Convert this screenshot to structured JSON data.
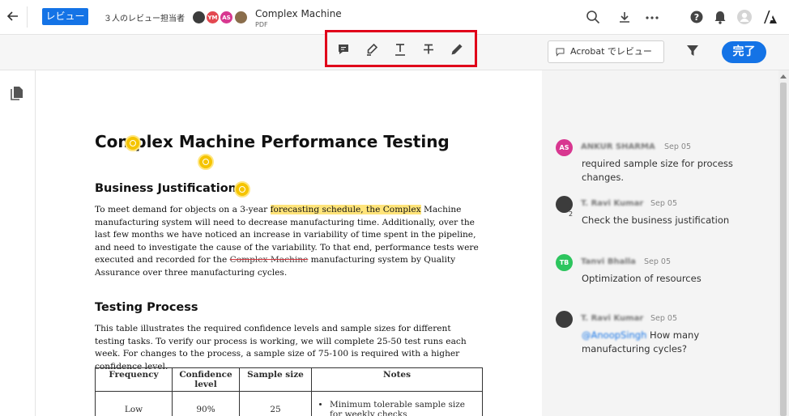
{
  "header": {
    "review_label": "レビュー",
    "reviewers_label": "３人のレビュー担当者",
    "avatars": [
      {
        "initials": "",
        "color": "#3c3c3c"
      },
      {
        "initials": "YM",
        "color": "#e34850"
      },
      {
        "initials": "AS",
        "color": "#d83790"
      },
      {
        "initials": "",
        "color": "#8a6d4b"
      }
    ],
    "doc_title": "Complex Machine",
    "doc_type": "PDF"
  },
  "toolbar": {
    "tools": [
      "comment-icon",
      "highlight-icon",
      "underline-icon",
      "strikethrough-icon",
      "draw-icon"
    ],
    "acrobat_review": "Acrobat でレビュー",
    "done_label": "完了"
  },
  "document": {
    "title": "Complex Machine Performance Testing",
    "section1_heading": "Business Justification",
    "p1_before": "To meet demand for objects on a 3-year ",
    "p1_highlight": "forecasting schedule, the Complex",
    "p1_mid": " Machine manufacturing system will need to decrease manufacturing time. Additionally, over the last few months we have noticed an increase in variability of time spent in the pipeline, and need to investigate the cause of the variability. To that end, performance tests were executed and recorded for the ",
    "p1_strike": "Complex Machine",
    "p1_after": " manufacturing system by Quality Assurance over three manufacturing cycles.",
    "section2_heading": "Testing Process",
    "p2": "This table illustrates the required confidence levels and sample sizes for different testing tasks. To verify our process is working, we will complete 25-50 test runs each week. For changes to the process, a sample size of 75-100 is required with a higher confidence level.",
    "table": {
      "headers": [
        "Frequency",
        "Confidence level",
        "Sample size",
        "Notes"
      ],
      "row1": {
        "frequency": "Low",
        "confidence": "90%",
        "sample": "25",
        "note": "Minimum tolerable sample size for weekly checks"
      }
    }
  },
  "comments": [
    {
      "initials": "AS",
      "color": "#d83790",
      "name": "ANKUR SHARMA",
      "date": "Sep 05",
      "text": "required sample size for process changes.",
      "mention": ""
    },
    {
      "initials": "",
      "color": "#3c3c3c",
      "name": "T. Ravi Kumar",
      "date": "Sep 05",
      "text": "Check the business justification",
      "mention": "",
      "badge": "2"
    },
    {
      "initials": "TB",
      "color": "#2dc55e",
      "name": "Tanvi Bhalla",
      "date": "Sep 05",
      "text": "Optimization of resources",
      "mention": ""
    },
    {
      "initials": "",
      "color": "#3c3c3c",
      "name": "T. Ravi Kumar",
      "date": "Sep 05",
      "text": " How many manufacturing cycles?",
      "mention": "@AnoopSingh"
    }
  ]
}
